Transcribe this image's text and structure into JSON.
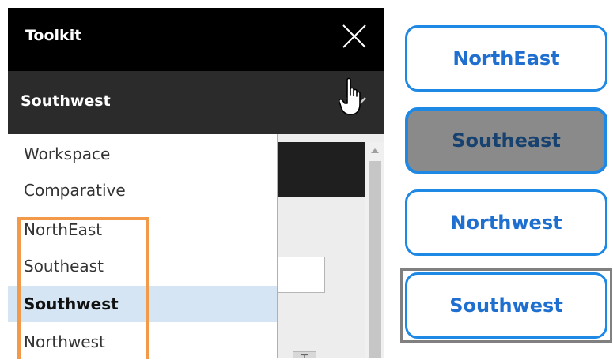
{
  "toolkit": {
    "title": "Toolkit",
    "selected_region": "Southwest"
  },
  "dropdown": {
    "options": [
      {
        "label": "Workspace",
        "selected": false
      },
      {
        "label": "Comparative",
        "selected": false
      },
      {
        "label": "NorthEast",
        "selected": false
      },
      {
        "label": "Southeast",
        "selected": false
      },
      {
        "label": "Southwest",
        "selected": true
      },
      {
        "label": "Northwest",
        "selected": false
      }
    ]
  },
  "regions": [
    {
      "label": "NorthEast",
      "active": false
    },
    {
      "label": "Southeast",
      "active": true
    },
    {
      "label": "Northwest",
      "active": false
    },
    {
      "label": "Southwest",
      "active": false
    }
  ],
  "colors": {
    "accent": "#1e88e5",
    "highlight": "#f2994a",
    "active_button": "#8a8a8a"
  }
}
